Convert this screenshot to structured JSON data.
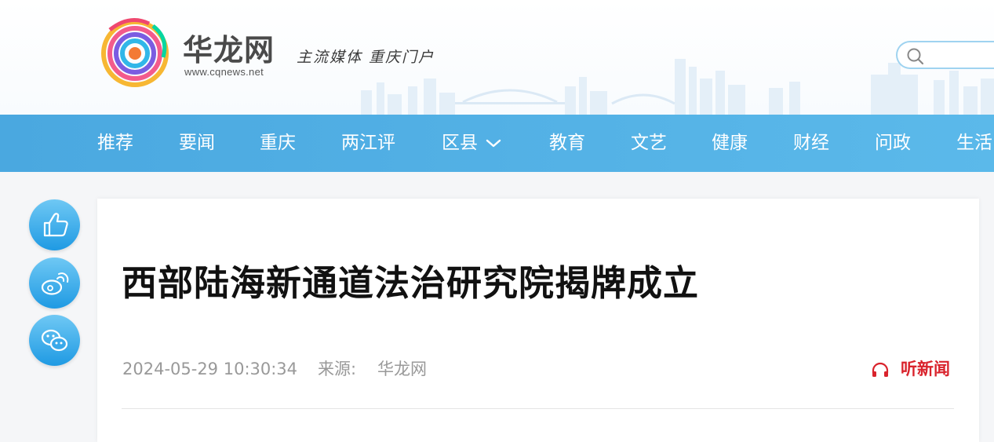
{
  "header": {
    "logo_cn": "华龙网",
    "logo_url": "www.cqnews.net",
    "slogan": "主流媒体  重庆门户",
    "search": {
      "placeholder": "",
      "value": ""
    }
  },
  "nav": {
    "items": [
      {
        "label": "推荐"
      },
      {
        "label": "要闻"
      },
      {
        "label": "重庆"
      },
      {
        "label": "两江评"
      },
      {
        "label": "区县",
        "has_dropdown": true
      },
      {
        "label": "教育"
      },
      {
        "label": "文艺"
      },
      {
        "label": "健康"
      },
      {
        "label": "财经"
      },
      {
        "label": "问政"
      },
      {
        "label": "生活"
      }
    ]
  },
  "share": {
    "icons": [
      "thumbs-up-icon",
      "weibo-icon",
      "wechat-icon"
    ]
  },
  "article": {
    "title": "西部陆海新通道法治研究院揭牌成立",
    "date": "2024-05-29 10:30:34",
    "source_label": "来源:",
    "source": "华龙网",
    "listen_label": "听新闻"
  },
  "colors": {
    "nav_bg": "#4aa8e0",
    "share_bg": "#1f9ae3",
    "listen": "#d9232c"
  }
}
